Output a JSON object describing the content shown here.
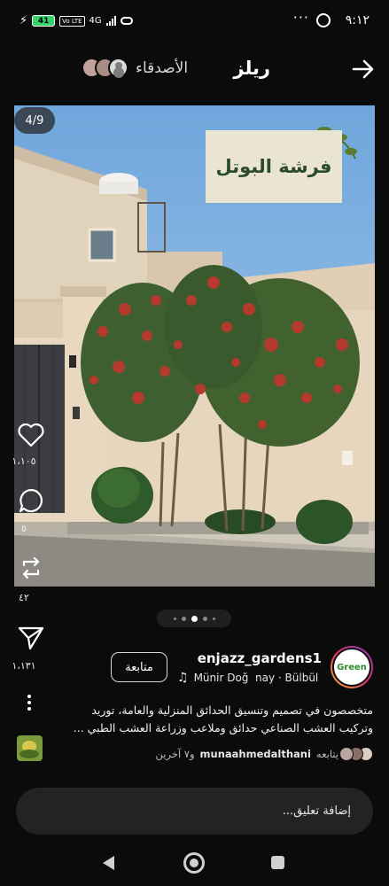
{
  "status_bar": {
    "time": "٩:١٢",
    "battery": "41",
    "network": "4G",
    "volte": "Vo LTE",
    "more": "···"
  },
  "header": {
    "title": "ريلز",
    "friends_label": "الأصدقاء"
  },
  "post": {
    "image_counter": "4/9",
    "overlay_title": "فرشة البوتل",
    "account": {
      "username": "enjazz_gardens1",
      "avatar_text": "Green",
      "follow_label": "متابعة",
      "music": "Münir Doğ  nay · Bülbül"
    },
    "caption_line1": "متخصصون في تصميم وتنسيق الحدائق المنزلية والعامة، توريد",
    "caption_line2": "وتركيب العشب الصناعي حدائق وملاعب وزراعة العشب الطبي ...",
    "followed_by_prefix": "يتابعه",
    "followed_by_name": "munaahmedalthani",
    "followed_by_suffix": "و٧ آخرين"
  },
  "actions": {
    "likes": "١،١٠٥",
    "comments": "٥",
    "reposts": "٤٢",
    "shares": "١،١٣١"
  },
  "carousel": {
    "total_dots": 5,
    "active_index": 3
  },
  "comment_input": {
    "placeholder": "إضافة تعليق..."
  },
  "colors": {
    "background": "#0b0b0c",
    "sky": "#7fb0df",
    "card": "#eae5d3",
    "card_text": "#2c4a2c"
  }
}
